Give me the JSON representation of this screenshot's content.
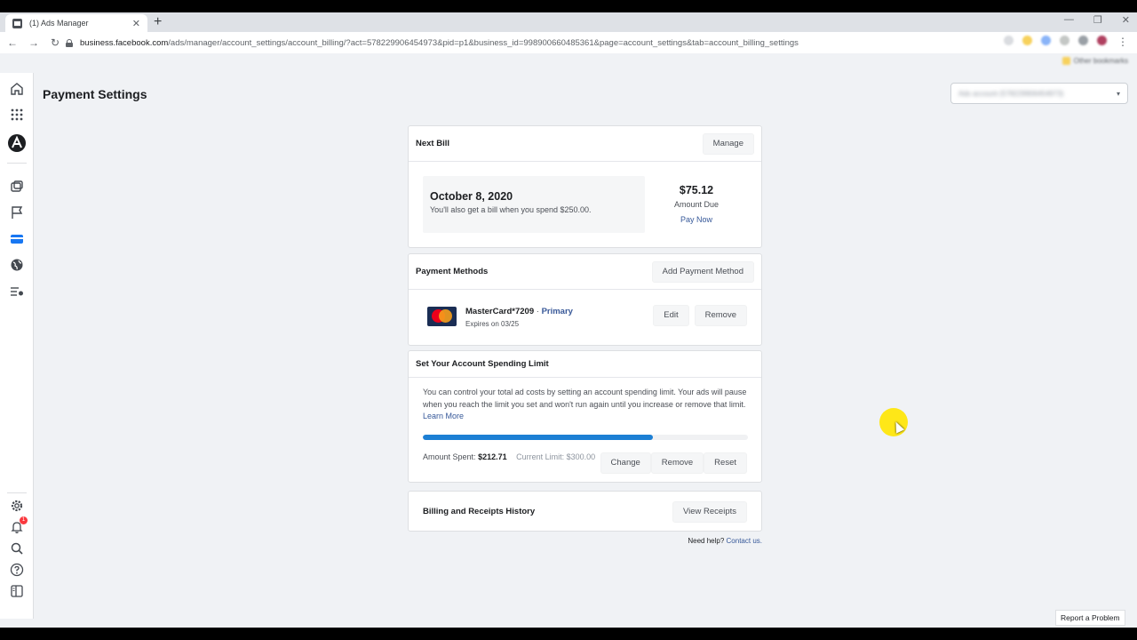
{
  "browser": {
    "tab_title": "(1) Ads Manager",
    "tab_close": "✕",
    "new_tab": "+",
    "url_host": "business.facebook.com",
    "url_path": "/ads/manager/account_settings/account_billing/?act=578229906454973&pid=p1&business_id=998900660485361&page=account_settings&tab=account_billing_settings",
    "bookmarks_label": "Other bookmarks",
    "win_minimize": "—",
    "win_restore": "❐",
    "win_close": "✕",
    "nav_back": "←",
    "nav_forward": "→",
    "nav_reload": "↻",
    "menu": "⋮"
  },
  "sidebar": {
    "notification_count": "1"
  },
  "page": {
    "title": "Payment Settings",
    "account_select_value": "Ads account (578229906454973)"
  },
  "next_bill": {
    "title": "Next Bill",
    "manage_label": "Manage",
    "date": "October 8, 2020",
    "note": "You'll also get a bill when you spend $250.00.",
    "amount": "$75.12",
    "amount_label": "Amount Due",
    "pay_label": "Pay Now"
  },
  "payment_methods": {
    "title": "Payment Methods",
    "add_label": "Add Payment Method",
    "card_name": "MasterCard*7209",
    "separator": " · ",
    "primary_label": "Primary",
    "expires": "Expires on 03/25",
    "edit_label": "Edit",
    "remove_label": "Remove"
  },
  "spending_limit": {
    "title": "Set Your Account Spending Limit",
    "description": "You can control your total ad costs by setting an account spending limit. Your ads will pause when you reach the limit you set and won't run again until you increase or remove that limit.",
    "learn_more": "Learn More",
    "progress_fraction": 0.709,
    "spent_label": "Amount Spent:",
    "spent_value": "$212.71",
    "current_limit": "Current Limit: $300.00",
    "change_label": "Change",
    "remove_label": "Remove",
    "reset_label": "Reset"
  },
  "receipts": {
    "title": "Billing and Receipts History",
    "view_label": "View Receipts"
  },
  "help": {
    "text": "Need help?",
    "link": "Contact us."
  },
  "report_label": "Report a Problem",
  "colors": {
    "accent": "#1c7fd4",
    "link": "#365899",
    "badge": "#fa383e"
  }
}
